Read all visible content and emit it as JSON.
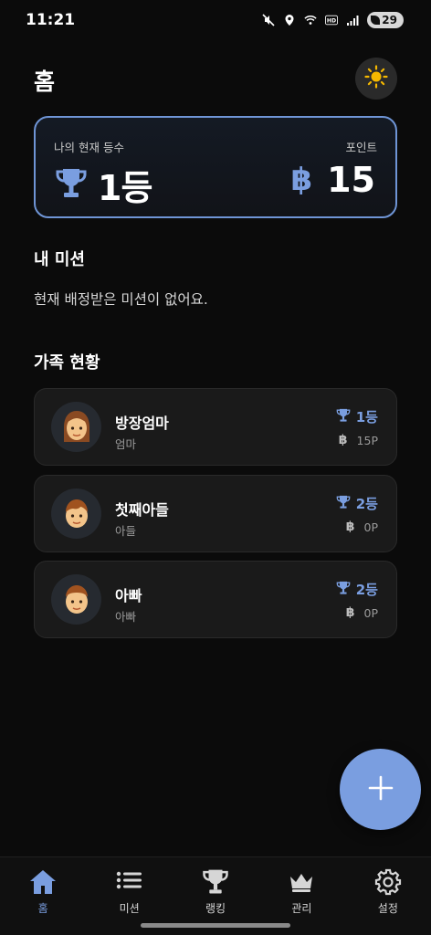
{
  "status_bar": {
    "time": "11:21",
    "battery": "29",
    "icons": [
      "mute-icon",
      "location-icon",
      "wifi-icon",
      "hd-icon",
      "signal-icon",
      "battery-icon"
    ]
  },
  "header": {
    "title": "홈",
    "theme_icon": "sun-icon"
  },
  "rank_card": {
    "rank_label": "나의 현재 등수",
    "rank_value": "1등",
    "points_label": "포인트",
    "points_value": "15",
    "currency_symbol": "฿"
  },
  "missions": {
    "title": "내 미션",
    "empty_text": "현재 배정받은 미션이 없어요."
  },
  "family": {
    "title": "가족 현황",
    "members": [
      {
        "name": "방장엄마",
        "role": "엄마",
        "rank": "1등",
        "points": "15P",
        "avatar": "woman-avatar"
      },
      {
        "name": "첫째아들",
        "role": "아들",
        "rank": "2등",
        "points": "0P",
        "avatar": "boy-avatar"
      },
      {
        "name": "아빠",
        "role": "아빠",
        "rank": "2등",
        "points": "0P",
        "avatar": "man-avatar"
      }
    ]
  },
  "fab": {
    "icon": "plus-icon"
  },
  "nav": {
    "items": [
      {
        "label": "홈",
        "icon": "home-icon",
        "active": true
      },
      {
        "label": "미션",
        "icon": "list-icon",
        "active": false
      },
      {
        "label": "랭킹",
        "icon": "trophy-icon",
        "active": false
      },
      {
        "label": "관리",
        "icon": "crown-icon",
        "active": false
      },
      {
        "label": "설정",
        "icon": "gear-icon",
        "active": false
      }
    ]
  },
  "colors": {
    "accent": "#7a9ee0",
    "background": "#0b0b0b",
    "card": "#1a1a1a",
    "sun": "#f5b800"
  }
}
